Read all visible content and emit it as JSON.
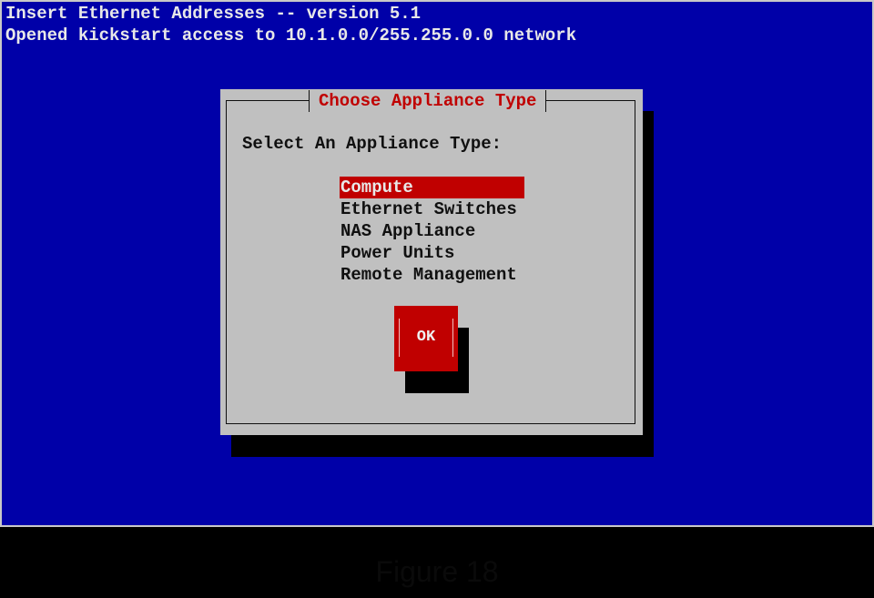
{
  "header": {
    "line1": "Insert Ethernet Addresses -- version 5.1",
    "line2": "Opened kickstart access to 10.1.0.0/255.255.0.0 network"
  },
  "dialog": {
    "title": "Choose Appliance Type",
    "prompt": "Select An Appliance Type:",
    "items": [
      {
        "label": "Compute",
        "selected": true
      },
      {
        "label": "Ethernet Switches",
        "selected": false
      },
      {
        "label": "NAS Appliance",
        "selected": false
      },
      {
        "label": "Power Units",
        "selected": false
      },
      {
        "label": "Remote Management",
        "selected": false
      }
    ],
    "ok_label": "OK"
  },
  "caption": "Figure 18",
  "colors": {
    "background": "#0000a8",
    "dialog": "#c0c0c0",
    "accent": "#c00000",
    "shadow": "#000000"
  }
}
